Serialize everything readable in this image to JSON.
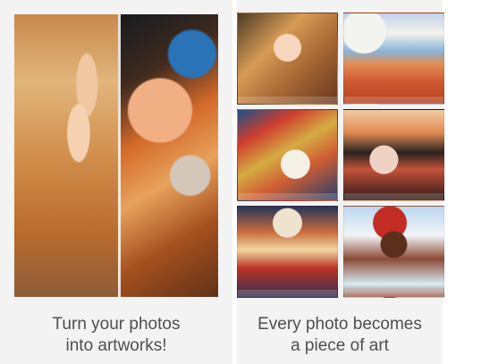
{
  "left_panel": {
    "caption_line_1": "Turn your photos",
    "caption_line_2": "into artworks!"
  },
  "right_panel": {
    "caption_line_1": "Every photo becomes",
    "caption_line_2": "a piece of art"
  }
}
